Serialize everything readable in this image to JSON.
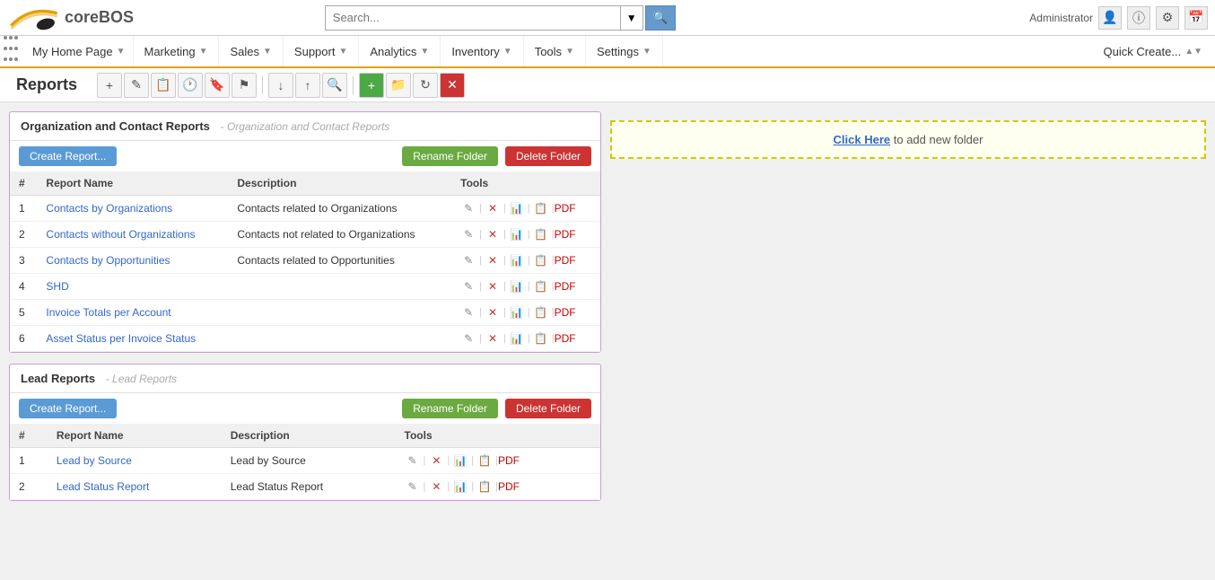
{
  "topbar": {
    "admin_label": "Administrator",
    "search_placeholder": "Search...",
    "icons": [
      "user-icon",
      "info-icon",
      "settings-icon",
      "calendar-icon"
    ]
  },
  "nav": {
    "app_name": "coreBOS",
    "home_label": "My Home Page",
    "items": [
      {
        "label": "Marketing",
        "has_arrow": true
      },
      {
        "label": "Sales",
        "has_arrow": true
      },
      {
        "label": "Support",
        "has_arrow": true
      },
      {
        "label": "Analytics",
        "has_arrow": true
      },
      {
        "label": "Inventory",
        "has_arrow": true
      },
      {
        "label": "Tools",
        "has_arrow": true
      },
      {
        "label": "Settings",
        "has_arrow": true
      }
    ],
    "quick_create_label": "Quick Create..."
  },
  "toolbar_icons": [
    "add-icon",
    "edit-icon",
    "copy-icon",
    "history-icon",
    "bookmark-icon",
    "flag-icon",
    "download-icon",
    "upload-icon",
    "search-icon",
    "add-green-icon",
    "archive-icon",
    "redo-icon",
    "delete-icon"
  ],
  "page_title": "Reports",
  "folders": [
    {
      "id": "org-contact",
      "title": "Organization and Contact Reports",
      "subtitle": "Organization and Contact Reports",
      "create_label": "Create Report...",
      "rename_label": "Rename Folder",
      "delete_label": "Delete Folder",
      "columns": [
        "#",
        "Report Name",
        "Description",
        "Tools"
      ],
      "rows": [
        {
          "num": 1,
          "name": "Contacts by Organizations",
          "description": "Contacts related to Organizations"
        },
        {
          "num": 2,
          "name": "Contacts without Organizations",
          "description": "Contacts not related to Organizations"
        },
        {
          "num": 3,
          "name": "Contacts by Opportunities",
          "description": "Contacts related to Opportunities"
        },
        {
          "num": 4,
          "name": "SHD",
          "description": ""
        },
        {
          "num": 5,
          "name": "Invoice Totals per Account",
          "description": ""
        },
        {
          "num": 6,
          "name": "Asset Status per Invoice Status",
          "description": ""
        }
      ]
    },
    {
      "id": "lead",
      "title": "Lead Reports",
      "subtitle": "Lead Reports",
      "create_label": "Create Report...",
      "rename_label": "Rename Folder",
      "delete_label": "Delete Folder",
      "columns": [
        "#",
        "Report Name",
        "Description",
        "Tools"
      ],
      "rows": [
        {
          "num": 1,
          "name": "Lead by Source",
          "description": "Lead by Source"
        },
        {
          "num": 2,
          "name": "Lead Status Report",
          "description": "Lead Status Report"
        }
      ]
    }
  ],
  "right_panel": {
    "click_here_label": "Click Here",
    "add_folder_text": " to add new folder"
  }
}
